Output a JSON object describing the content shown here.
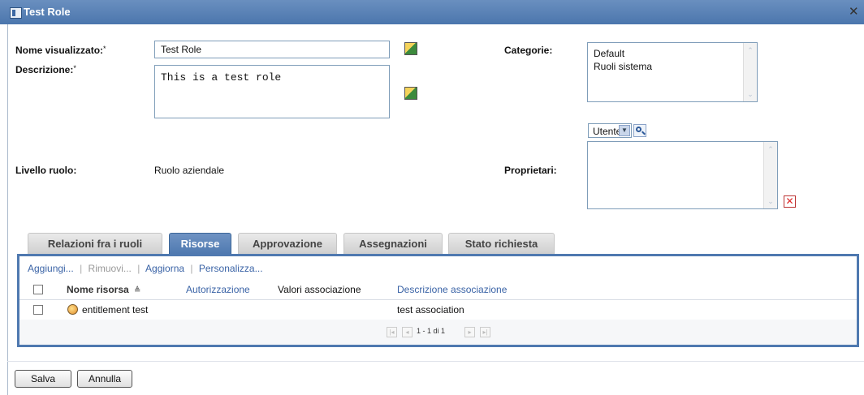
{
  "window": {
    "title": "Test Role",
    "title_icon": "role-icon",
    "close_icon": "close-icon"
  },
  "form": {
    "display_name_label": "Nome visualizzato:",
    "display_name_value": "Test Role",
    "description_label": "Descrizione:",
    "description_value": "This is a test role",
    "required_mark": "*",
    "categories_label": "Categorie:",
    "categories": [
      "Default",
      "Ruoli sistema"
    ],
    "role_level_label": "Livello ruolo:",
    "role_level_value": "Ruolo aziendale",
    "owners_label": "Proprietari:",
    "owner_type_selected": "Utente",
    "translate_icon": "language-editor-icon",
    "search_icon": "magnifier-icon",
    "remove_icon": "red-x-icon"
  },
  "tabs": [
    {
      "label": "Relazioni fra i ruoli",
      "active": false
    },
    {
      "label": "Risorse",
      "active": true
    },
    {
      "label": "Approvazione",
      "active": false
    },
    {
      "label": "Assegnazioni",
      "active": false
    },
    {
      "label": "Stato richiesta",
      "active": false
    }
  ],
  "resources": {
    "actions": {
      "add": "Aggiungi...",
      "remove": "Rimuovi...",
      "refresh": "Aggiorna",
      "customize": "Personalizza...",
      "separator": "|"
    },
    "columns": {
      "name": "Nome risorsa",
      "sort_indicator": "≜",
      "authorization": "Autorizzazione",
      "association_values": "Valori associazione",
      "association_description": "Descrizione associazione"
    },
    "rows": [
      {
        "name": "entitlement test",
        "authorization": "",
        "association_values": "",
        "association_description": "test association",
        "icon": "entitlement-icon"
      }
    ],
    "pagination": {
      "text": "1 - 1 di 1"
    }
  },
  "footer": {
    "save": "Salva",
    "cancel": "Annulla"
  },
  "colors": {
    "titlebar": "#5a82b8",
    "active_tab": "#4f79b0",
    "link": "#3a63a6"
  }
}
